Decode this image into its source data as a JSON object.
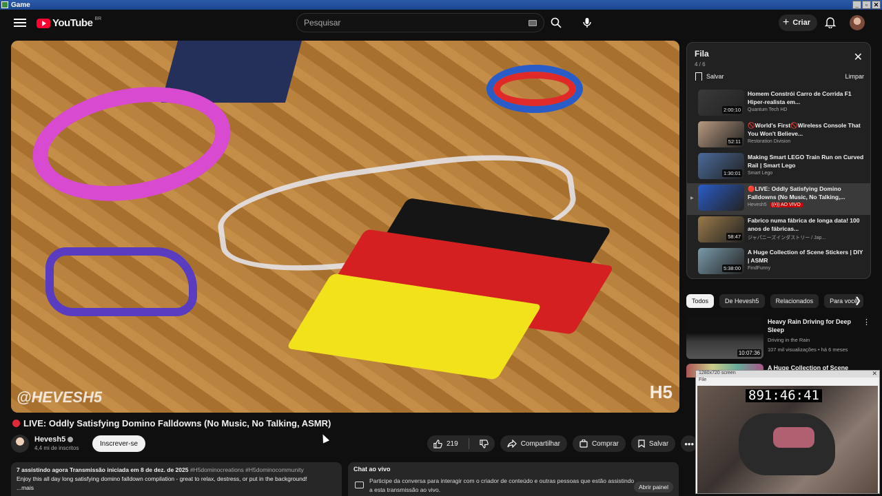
{
  "window": {
    "title": "Game",
    "controls": [
      "_",
      "▫",
      "✕"
    ]
  },
  "header": {
    "logo_text": "YouTube",
    "region": "BR",
    "search_placeholder": "Pesquisar",
    "create_label": "Criar"
  },
  "video": {
    "title": "LIVE: Oddly Satisfying Domino Falldowns (No Music, No Talking, ASMR)",
    "watermark": "@HEVESH5",
    "channel": "Hevesh5",
    "subscribers": "4,4 mi de inscritos",
    "subscribe_label": "Inscrever-se",
    "likes": "219",
    "share_label": "Compartilhar",
    "buy_label": "Comprar",
    "save_label": "Salvar"
  },
  "description": {
    "meta": "7 assistindo agora  Transmissão iniciada em 8 de dez. de 2025",
    "tags": "#H5dominocreations #H5dominocommunity",
    "text": "Enjoy this all day long satisfying domino falldown compilation - great to relax, destress, or put in the background!",
    "more": "...mais"
  },
  "chat": {
    "title": "Chat ao vivo",
    "text": "Participe da conversa para interagir com o criador de conteúdo e outras pessoas que estão assistindo a esta transmissão ao vivo.",
    "open_label": "Abrir painel"
  },
  "queue": {
    "title": "Fila",
    "count": "4 / 6",
    "save_label": "Salvar",
    "clear_label": "Limpar",
    "items": [
      {
        "title": "Homem Constrói Carro de Corrida F1 Hiper-realista em...",
        "channel": "Quantum Tech HD",
        "duration": "2:00:10",
        "thumb_color": "#3a3a3a"
      },
      {
        "title": "🚫World's First🚫Wireless Console That You Won't Believe...",
        "channel": "Restoration Division",
        "duration": "52:11",
        "thumb_color": "#b89a80"
      },
      {
        "title": "Making Smart LEGO Train Run on Curved Rail | Smart Lego",
        "channel": "Smart Lego",
        "duration": "1:30:01",
        "thumb_color": "#4a6a9a"
      },
      {
        "title": "🔴LIVE: Oddly Satisfying Domino Falldowns (No Music, No Talking,...",
        "channel": "Hevesh5",
        "live_badge": "((•)) AO VIVO",
        "thumb_color": "#2a5cc8"
      },
      {
        "title": "Fabrico numa fábrica de longa data! 100 anos de fábricas...",
        "channel": "ジャパニーズインダストリー / Jap...",
        "duration": "58:47",
        "thumb_color": "#9a7a4a"
      },
      {
        "title": "A Huge Collection of Scene Stickers | DIY | ASMR",
        "channel": "FindFunny",
        "duration": "5:38:00",
        "thumb_color": "#7a9aaa"
      }
    ]
  },
  "chips": [
    "Todos",
    "De Hevesh5",
    "Relacionados",
    "Para você"
  ],
  "recommendations": [
    {
      "title": "Heavy Rain Driving for Deep Sleep",
      "channel": "Driving in the Rain",
      "meta": "107 mil visualizações • há 6 meses",
      "duration": "10:07:36"
    },
    {
      "title": "A Huge Collection of Scene"
    }
  ],
  "overlay": {
    "title": "1280x720 screen",
    "menu": "File",
    "clock": "891:46:41"
  }
}
